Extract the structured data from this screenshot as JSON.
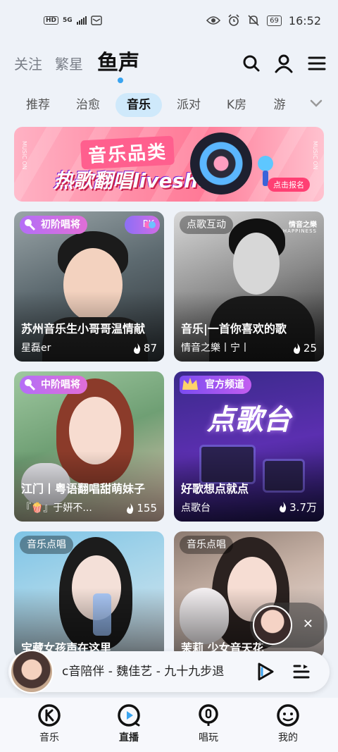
{
  "status_bar": {
    "hd": "HD",
    "net": "5G",
    "battery": "69",
    "time": "16:52"
  },
  "top_nav": {
    "tabs": [
      "关注",
      "繁星",
      "鱼声"
    ],
    "active": 2
  },
  "categories": [
    "推荐",
    "治愈",
    "音乐",
    "派对",
    "K房",
    "游"
  ],
  "active_category": "音乐",
  "banner": {
    "title": "音乐品类",
    "subtitle": "热歌翻唱liveshow",
    "button": "点击报名",
    "side_text": "MUSIC ON"
  },
  "cards": [
    {
      "tag": "初阶唱将",
      "pk": "PK",
      "title": "苏州音乐生小哥哥温情献",
      "host": "星磊er",
      "heat": "87"
    },
    {
      "tag": "点歌互动",
      "title": "音乐|一首你喜欢的歌",
      "host": "情音之樂丨宁丨",
      "heat": "25",
      "brand": "情音之樂",
      "brand_sub": "HAPPINESS"
    },
    {
      "tag": "中阶唱将",
      "title": "江门丨粤语翻唱甜萌妹子",
      "host": "『🍿』于妍不...",
      "heat": "155"
    },
    {
      "tag": "官方频道",
      "title": "好歌想点就点",
      "host": "点歌台",
      "heat": "3.7万",
      "poster_text": "点歌台"
    },
    {
      "tag": "音乐点唱",
      "title": "宝藏女孩声在这里"
    },
    {
      "tag": "音乐点唱",
      "title": "茉莉 少女音天花"
    }
  ],
  "player": {
    "song": "c音陪伴 - 魏佳艺 - 九十九步退"
  },
  "bottom_nav": {
    "items": [
      "音乐",
      "直播",
      "唱玩",
      "我的"
    ],
    "active": 1
  }
}
